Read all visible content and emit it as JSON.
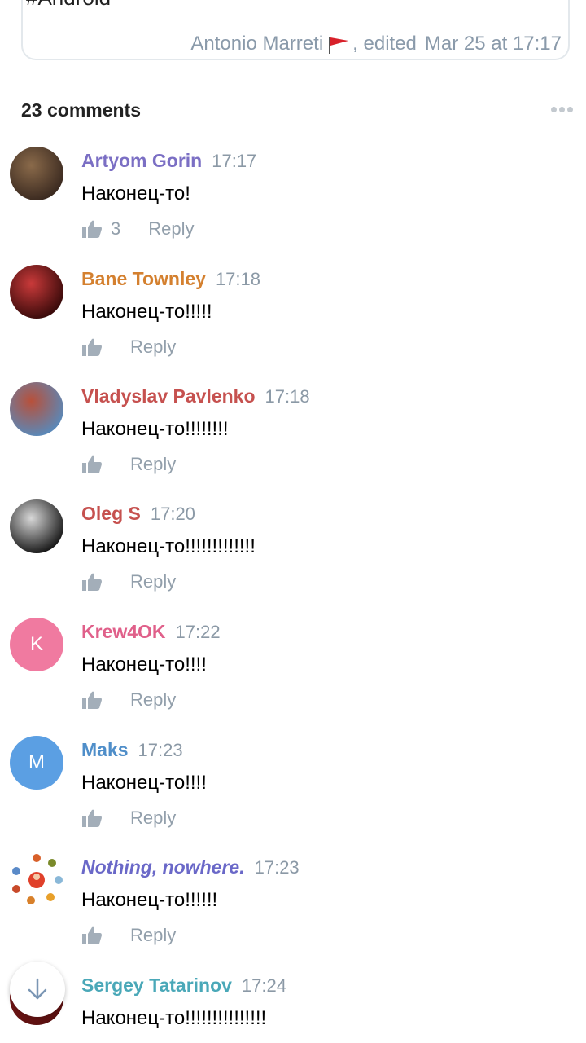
{
  "post": {
    "hashtag": "#Android",
    "author": "Antonio Marreti",
    "edited_label": ", edited",
    "date": "Mar 25 at 17:17"
  },
  "comments_header": "23 comments",
  "reply_label": "Reply",
  "comments": [
    {
      "author": "Artyom Gorin",
      "time": "17:17",
      "text": "Наконец-то!",
      "likes": "3",
      "name_color": "#7b6fc4",
      "avatar": "photo",
      "avatar_colors": [
        "#3b2a20",
        "#8a6a4a"
      ]
    },
    {
      "author": "Bane Townley",
      "time": "17:18",
      "text": "Наконец-то!!!!!",
      "likes": "",
      "name_color": "#d4802f",
      "avatar": "photo",
      "avatar_colors": [
        "#3a0a0a",
        "#c93a3a"
      ]
    },
    {
      "author": "Vladyslav Pavlenko",
      "time": "17:18",
      "text": "Наконец-то!!!!!!!!",
      "likes": "",
      "name_color": "#c6514f",
      "avatar": "photo",
      "avatar_colors": [
        "#5a88b8",
        "#b8503a"
      ]
    },
    {
      "author": "Oleg S",
      "time": "17:20",
      "text": "Наконец-то!!!!!!!!!!!!!",
      "likes": "",
      "name_color": "#c6514f",
      "avatar": "photo",
      "avatar_colors": [
        "#1a1a1a",
        "#d8d8d8"
      ]
    },
    {
      "author": "Krew4OK",
      "time": "17:22",
      "text": "Наконец-то!!!!",
      "likes": "",
      "name_color": "#e0608a",
      "avatar": "letter",
      "avatar_letter": "K",
      "avatar_bg": "#f07aa0"
    },
    {
      "author": "Maks",
      "time": "17:23",
      "text": "Наконец-то!!!!",
      "likes": "",
      "name_color": "#4f8ec9",
      "avatar": "letter",
      "avatar_letter": "M",
      "avatar_bg": "#5b9fe3"
    },
    {
      "author": "Nothing, nowhere.",
      "time": "17:23",
      "text": "Наконец-то!!!!!!",
      "likes": "",
      "name_color": "#6a68c8",
      "avatar": "icons",
      "italic": true
    },
    {
      "author": "Sergey Tatarinov",
      "time": "17:24",
      "text": "Наконец-то!!!!!!!!!!!!!!!",
      "likes": "",
      "name_color": "#4aa8b8",
      "avatar": "photo",
      "avatar_colors": [
        "#5a1010",
        "#a02020"
      ]
    }
  ],
  "icons": {
    "like": "thumbs-up-icon",
    "more": "more-dots-icon",
    "scroll": "arrow-down-icon",
    "flag": "red-flag-icon"
  }
}
